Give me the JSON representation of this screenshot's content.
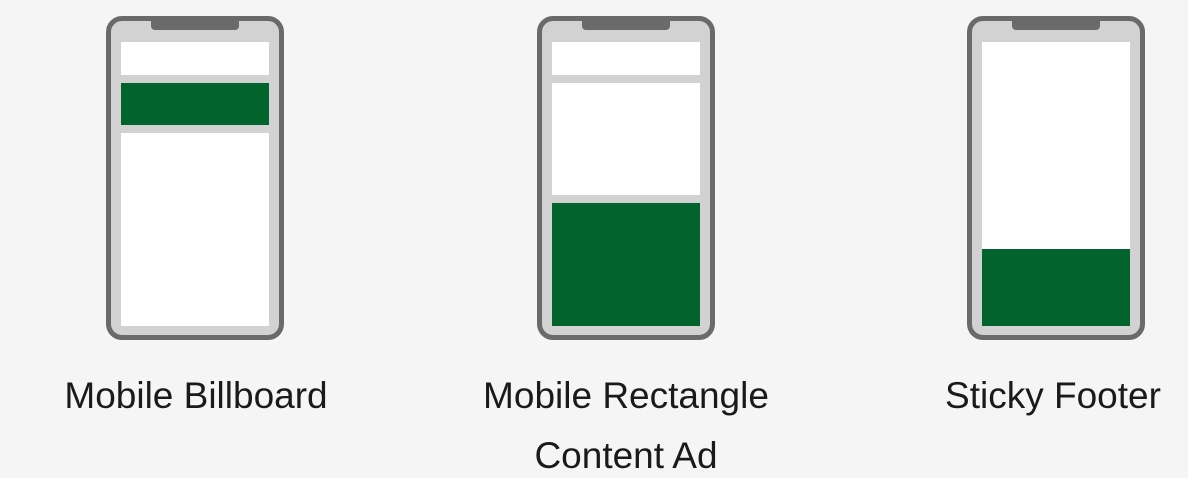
{
  "colors": {
    "background": "#f5f5f5",
    "phone_frame": "#6a6a6a",
    "phone_bezel": "#d2d2d2",
    "screen_content": "#ffffff",
    "ad_accent": "#02632c"
  },
  "formats": [
    {
      "id": "mobile-billboard",
      "title": "Mobile Billboard",
      "subtitle": ""
    },
    {
      "id": "mobile-rectangle",
      "title": "Mobile Rectangle",
      "subtitle": "Content Ad"
    },
    {
      "id": "sticky-footer",
      "title": "Sticky Footer",
      "subtitle": ""
    }
  ]
}
